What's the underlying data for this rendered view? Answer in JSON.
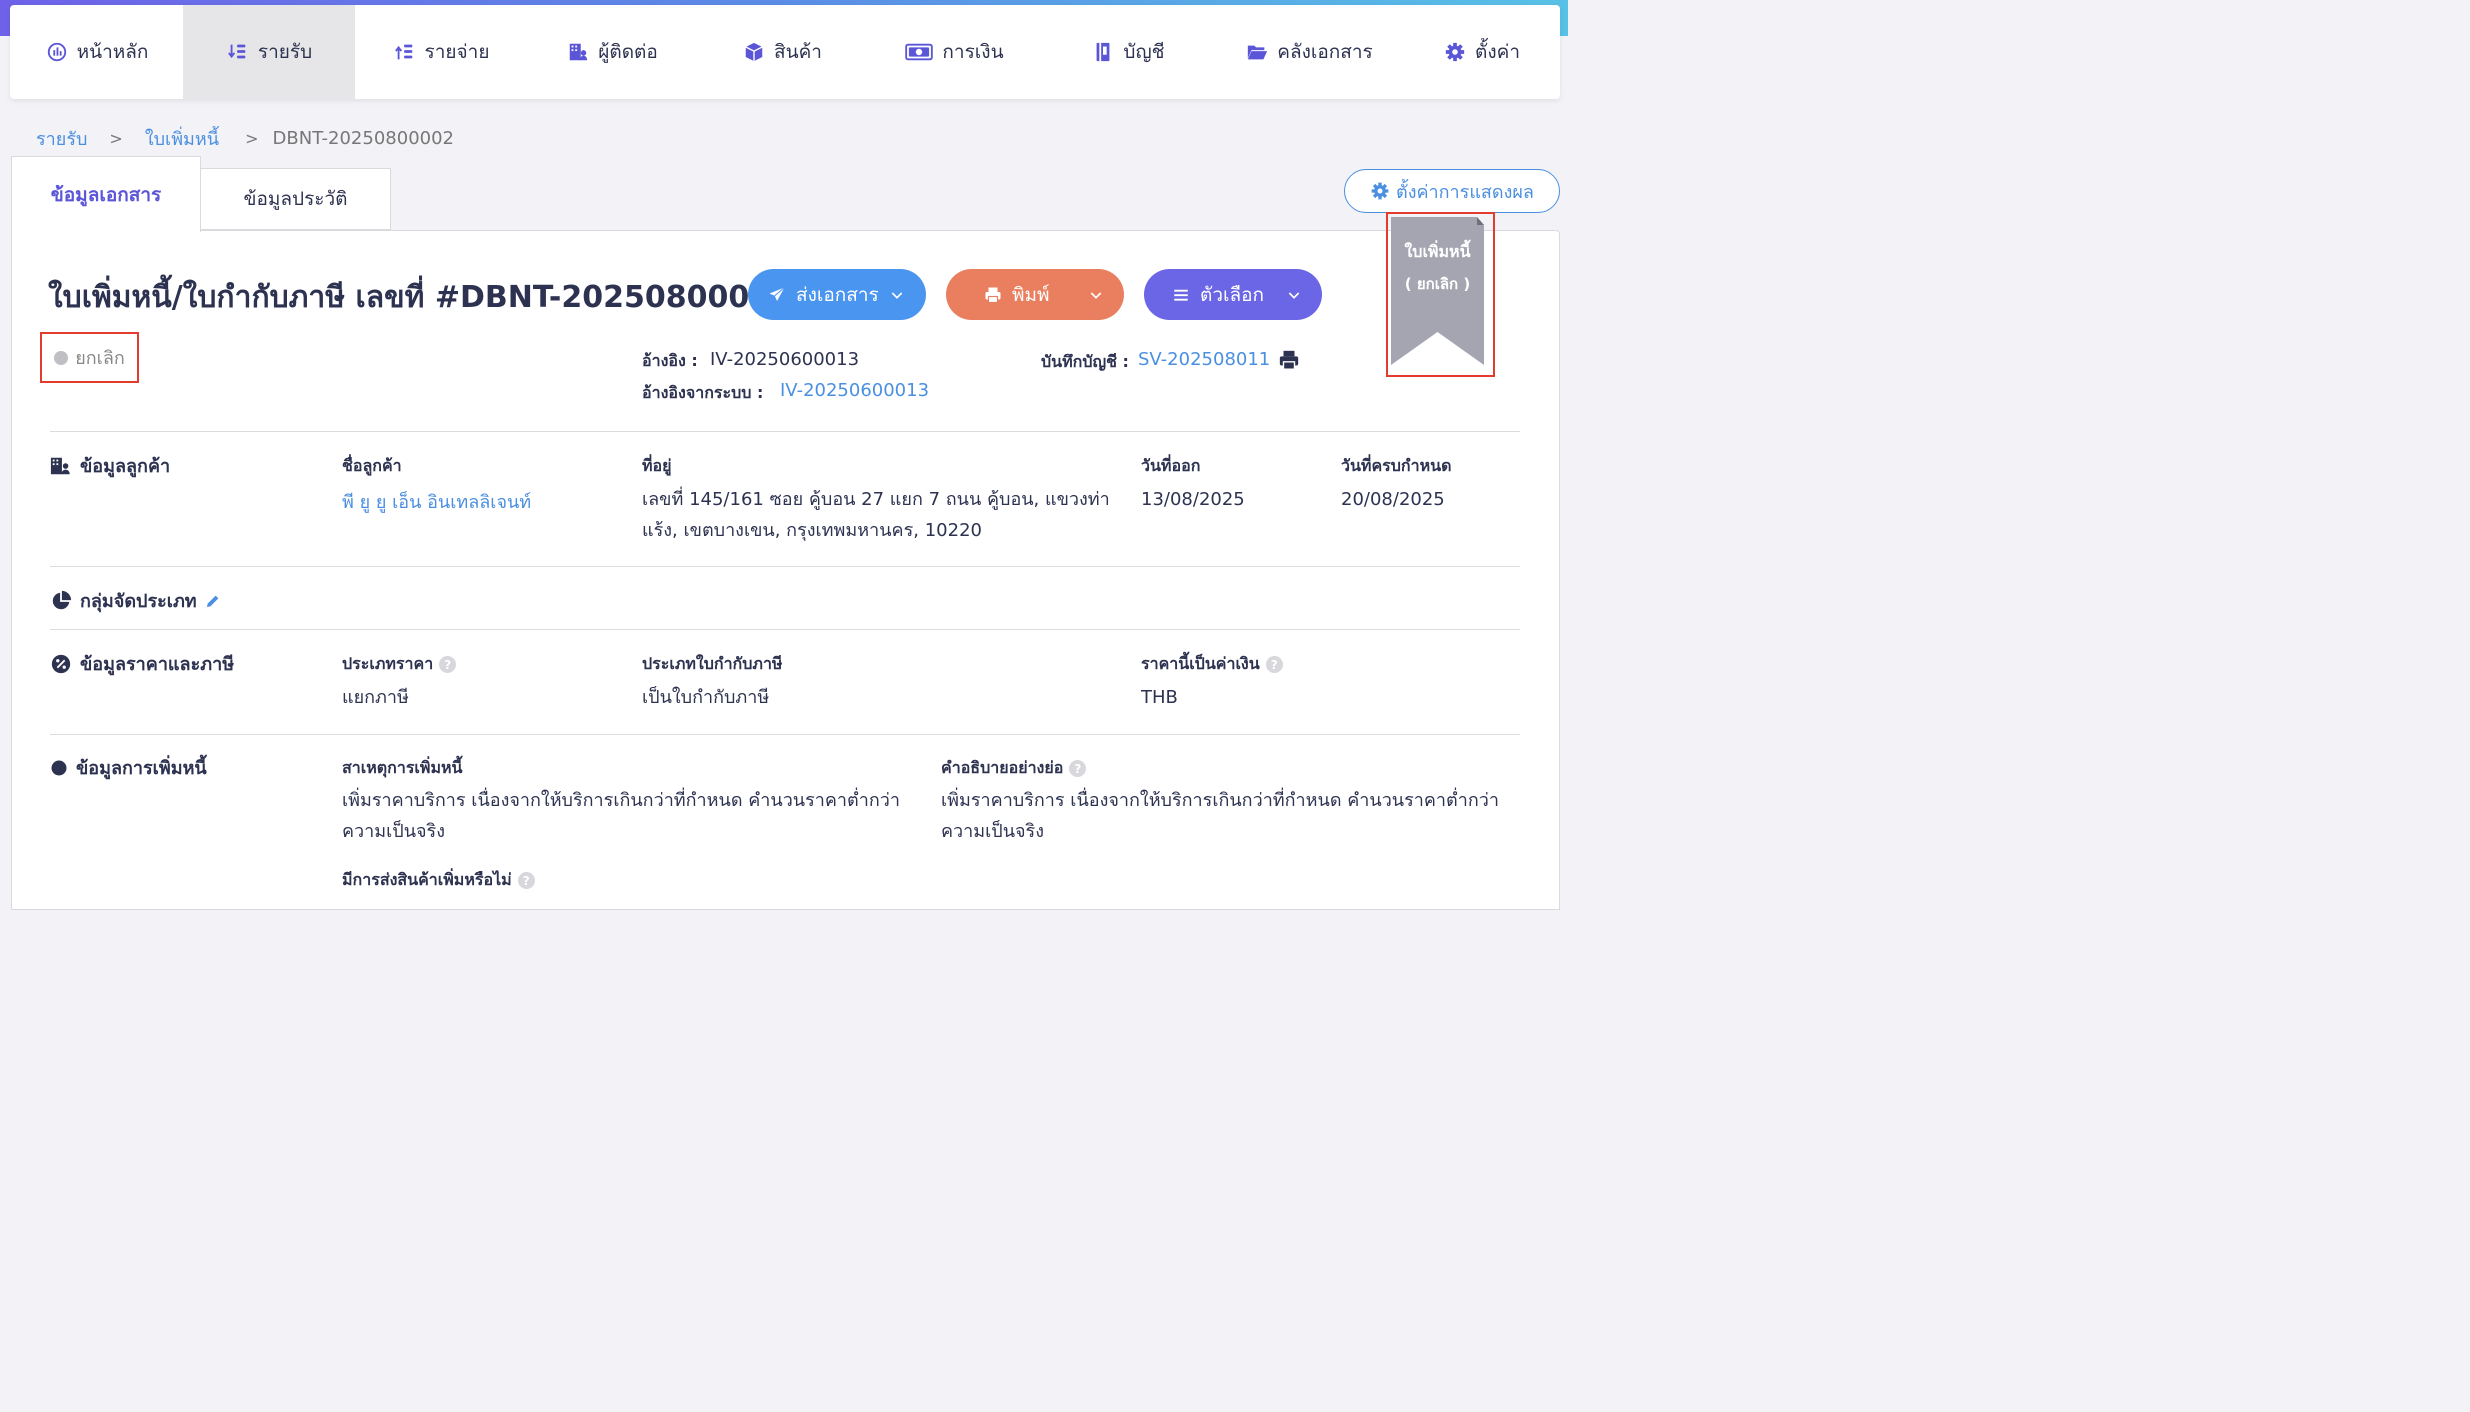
{
  "nav": {
    "items": [
      {
        "label": "หน้าหลัก",
        "icon": "dashboard-icon"
      },
      {
        "label": "รายรับ",
        "icon": "income-icon",
        "active": true
      },
      {
        "label": "รายจ่าย",
        "icon": "expense-icon"
      },
      {
        "label": "ผู้ติดต่อ",
        "icon": "contacts-icon"
      },
      {
        "label": "สินค้า",
        "icon": "box-icon"
      },
      {
        "label": "การเงิน",
        "icon": "money-icon"
      },
      {
        "label": "บัญชี",
        "icon": "book-icon"
      },
      {
        "label": "คลังเอกสาร",
        "icon": "folder-icon"
      },
      {
        "label": "ตั้งค่า",
        "icon": "gear-icon"
      }
    ]
  },
  "breadcrumb": {
    "level1": "รายรับ",
    "level2": "ใบเพิ่มหนี้",
    "current": "DBNT-20250800002",
    "sep": ">"
  },
  "tabs": {
    "doc": "ข้อมูลเอกสาร",
    "history": "ข้อมูลประวัติ"
  },
  "display_settings": "ตั้งค่าการแสดงผล",
  "doc": {
    "title": "ใบเพิ่มหนี้/ใบกำกับภาษี เลขที่ #DBNT-20250800002",
    "status": "ยกเลิก",
    "ref_label": "อ้างอิง :",
    "ref_value": "IV-20250600013",
    "sys_ref_label": "อ้างอิงจากระบบ :",
    "sys_ref_value": "IV-20250600013",
    "journal_label": "บันทึกบัญชี :",
    "journal_value": "SV-202508011"
  },
  "buttons": {
    "send": "ส่งเอกสาร",
    "print": "พิมพ์",
    "options": "ตัวเลือก"
  },
  "ribbon": {
    "line1": "ใบเพิ่มหนี้",
    "line2": "( ยกเลิก )",
    "color": "#a4a5b1"
  },
  "customer": {
    "section": "ข้อมูลลูกค้า",
    "name_label": "ชื่อลูกค้า",
    "name": "พี ยู ยู เอ็น อินเทลลิเจนท์",
    "address_label": "ที่อยู่",
    "address_line1": "เลขที่ 145/161 ซอย คู้บอน 27 แยก 7 ถนน คู้บอน, แขวงท่า",
    "address_line2": "แร้ง, เขตบางเขน, กรุงเทพมหานคร, 10220",
    "issue_label": "วันที่ออก",
    "issue_date": "13/08/2025",
    "due_label": "วันที่ครบกำหนด",
    "due_date": "20/08/2025"
  },
  "category": {
    "section": "กลุ่มจัดประเภท"
  },
  "pricing": {
    "section": "ข้อมูลราคาและภาษี",
    "price_type_label": "ประเภทราคา",
    "price_type": "แยกภาษี",
    "tax_type_label": "ประเภทใบกำกับภาษี",
    "tax_type": "เป็นใบกำกับภาษี",
    "currency_label": "ราคานี้เป็นค่าเงิน",
    "currency": "THB"
  },
  "debit": {
    "section": "ข้อมูลการเพิ่มหนี้",
    "reason_label": "สาเหตุการเพิ่มหนี้",
    "reason_line1": "เพิ่มราคาบริการ เนื่องจากให้บริการเกินกว่าที่กำหนด คำนวนราคาต่ำกว่า",
    "reason_line2": "ความเป็นจริง",
    "desc_label": "คำอธิบายอย่างย่อ",
    "desc_line1": "เพิ่มราคาบริการ เนื่องจากให้บริการเกินกว่าที่กำหนด คำนวนราคาต่ำกว่า",
    "desc_line2": "ความเป็นจริง",
    "extra_label": "มีการส่งสินค้าเพิ่มหรือไม่"
  },
  "help_glyph": "?"
}
